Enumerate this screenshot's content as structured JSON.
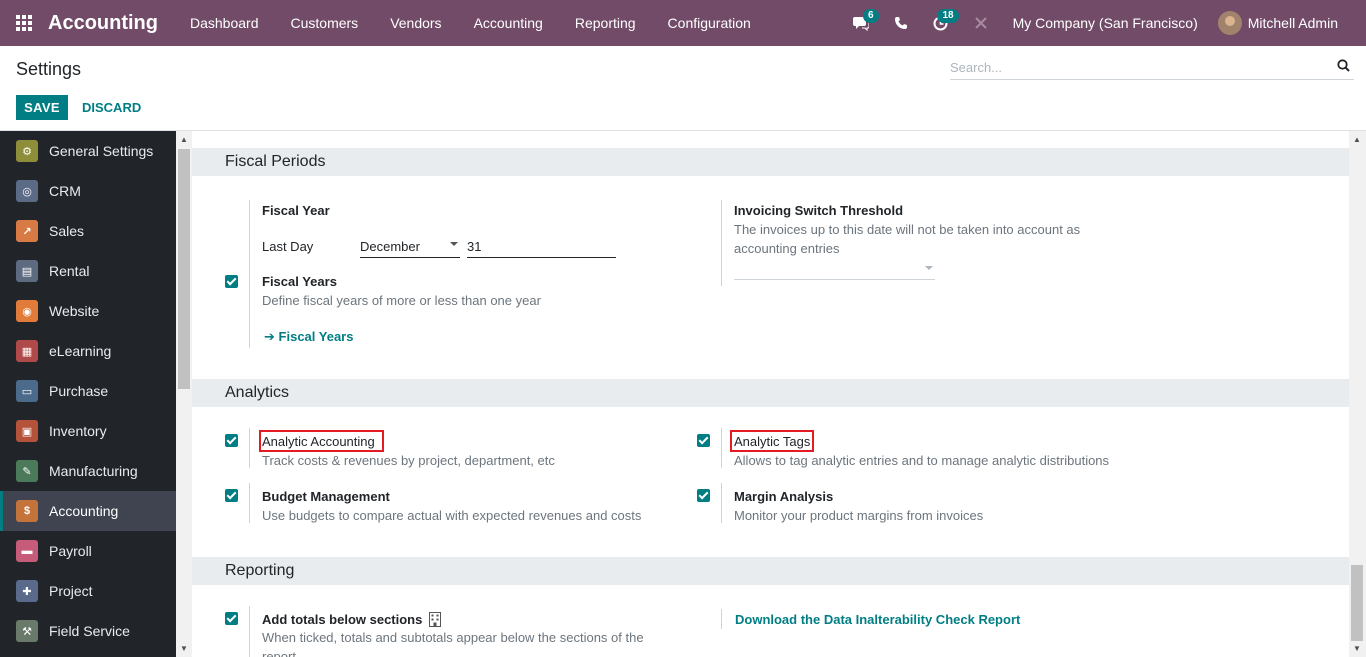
{
  "navbar": {
    "app_title": "Accounting",
    "menu": [
      "Dashboard",
      "Customers",
      "Vendors",
      "Accounting",
      "Reporting",
      "Configuration"
    ],
    "messages_badge": "6",
    "activities_badge": "18",
    "company": "My Company (San Francisco)",
    "user": "Mitchell Admin"
  },
  "control": {
    "title": "Settings",
    "search_placeholder": "Search...",
    "save_label": "SAVE",
    "discard_label": "DISCARD"
  },
  "sidebar": {
    "items": [
      {
        "label": "General Settings",
        "color": "#8e8e3a",
        "glyph": "⚙"
      },
      {
        "label": "CRM",
        "color": "#5b6b86",
        "glyph": "◎"
      },
      {
        "label": "Sales",
        "color": "#d77a43",
        "glyph": "↗"
      },
      {
        "label": "Rental",
        "color": "#5c6b80",
        "glyph": "▤"
      },
      {
        "label": "Website",
        "color": "#e07b39",
        "glyph": "◉"
      },
      {
        "label": "eLearning",
        "color": "#b04a4a",
        "glyph": "▦"
      },
      {
        "label": "Purchase",
        "color": "#4c6a8a",
        "glyph": "▭"
      },
      {
        "label": "Inventory",
        "color": "#b5523b",
        "glyph": "▣"
      },
      {
        "label": "Manufacturing",
        "color": "#4a7a5a",
        "glyph": "✎"
      },
      {
        "label": "Accounting",
        "color": "#c4733a",
        "glyph": "$"
      },
      {
        "label": "Payroll",
        "color": "#c75b7a",
        "glyph": "▬"
      },
      {
        "label": "Project",
        "color": "#5a6a8a",
        "glyph": "✚"
      },
      {
        "label": "Field Service",
        "color": "#6a7a6a",
        "glyph": "⚒"
      }
    ],
    "active_index": 9
  },
  "fiscal": {
    "header": "Fiscal Periods",
    "fiscal_year_title": "Fiscal Year",
    "last_day_label": "Last Day",
    "month": "December",
    "day": "31",
    "fiscal_years_title": "Fiscal Years",
    "fiscal_years_desc": "Define fiscal years of more or less than one year",
    "fiscal_years_link": "Fiscal Years",
    "threshold_title": "Invoicing Switch Threshold",
    "threshold_desc": "The invoices up to this date will not be taken into account as accounting entries"
  },
  "analytics": {
    "header": "Analytics",
    "analytic_accounting_title": "Analytic Accounting",
    "analytic_accounting_desc": "Track costs & revenues by project, department, etc",
    "analytic_tags_title": "Analytic Tags",
    "analytic_tags_desc": "Allows to tag analytic entries and to manage analytic distributions",
    "budget_title": "Budget Management",
    "budget_desc": "Use budgets to compare actual with expected revenues and costs",
    "margin_title": "Margin Analysis",
    "margin_desc": "Monitor your product margins from invoices"
  },
  "reporting": {
    "header": "Reporting",
    "totals_title": "Add totals below sections",
    "totals_desc": "When ticked, totals and subtotals appear below the sections of the report",
    "download_link": "Download the Data Inalterability Check Report"
  }
}
